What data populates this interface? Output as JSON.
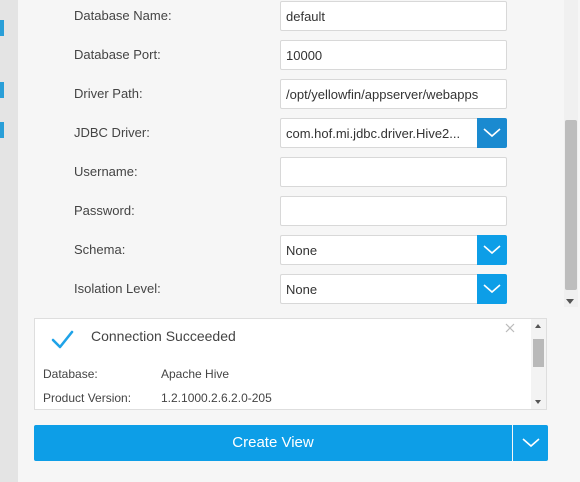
{
  "form": {
    "fields": [
      {
        "label": "Database Name:",
        "value": "default"
      },
      {
        "label": "Database Port:",
        "value": "10000"
      },
      {
        "label": "Driver Path:",
        "value": "/opt/yellowfin/appserver/webapps"
      },
      {
        "label": "JDBC Driver:",
        "value": "com.hof.mi.jdbc.driver.Hive2..."
      },
      {
        "label": "Username:",
        "value": ""
      },
      {
        "label": "Password:",
        "value": ""
      },
      {
        "label": "Schema:",
        "value": "None"
      },
      {
        "label": "Isolation Level:",
        "value": "None"
      }
    ]
  },
  "connection": {
    "title": "Connection Succeeded",
    "details": [
      {
        "key": "Database:",
        "value": "Apache Hive"
      },
      {
        "key": "Product Version:",
        "value": "1.2.1000.2.6.2.0-205"
      }
    ]
  },
  "actions": {
    "create_label": "Create View"
  },
  "colors": {
    "accent": "#0d9ee7",
    "success_check": "#1fa3e8"
  },
  "icons": {
    "dropdown": "chevron-down-icon",
    "success": "checkmark-icon",
    "close": "close-icon"
  }
}
